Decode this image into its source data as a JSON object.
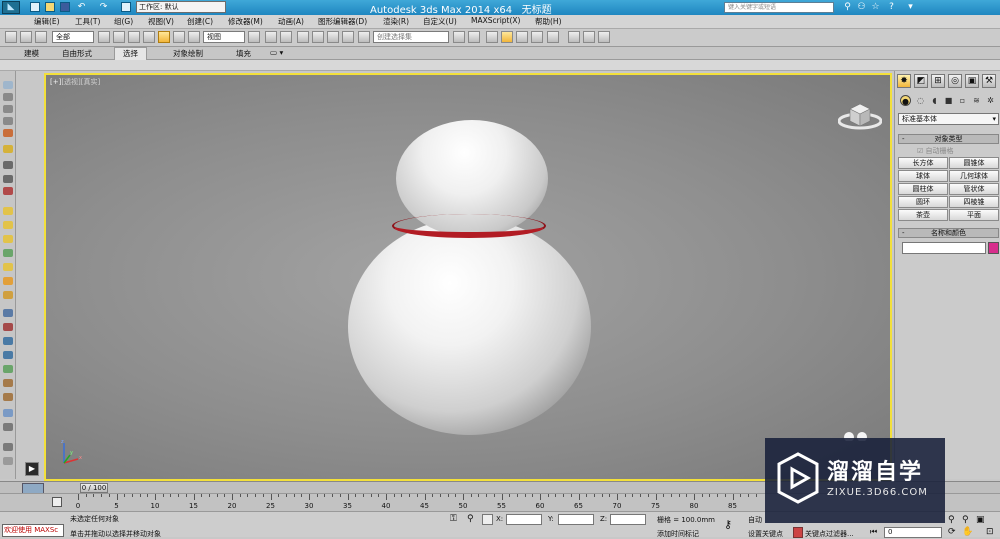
{
  "titlebar": {
    "workspace": "工作区: 默认",
    "app_title": "Autodesk 3ds Max  2014 x64",
    "doc_title": "无标题",
    "search_placeholder": "键入关键字或短语",
    "ime": "中 ⁾ • ♦ ⚙"
  },
  "menu": [
    "编辑(E)",
    "工具(T)",
    "组(G)",
    "视图(V)",
    "创建(C)",
    "修改器(M)",
    "动画(A)",
    "图形编辑器(D)",
    "渲染(R)",
    "自定义(U)",
    "MAXScript(X)",
    "帮助(H)"
  ],
  "toolbar": {
    "selection_filter": "全部",
    "ref_coord": "视图",
    "named_selection": "创建选择集"
  },
  "ribbon": {
    "tabs": [
      "建模",
      "自由形式",
      "选择",
      "对象绘制",
      "填充"
    ],
    "active": "选择"
  },
  "viewport": {
    "label_plus": "[+]",
    "label_view": "[透视]",
    "label_shading": "[真实]",
    "border_color": "#f3e03a"
  },
  "command_panel": {
    "category": "标准基本体",
    "rollout_object_type": "对象类型",
    "autogrid": "自动栅格",
    "objects": [
      "长方体",
      "圆锥体",
      "球体",
      "几何球体",
      "圆柱体",
      "管状体",
      "圆环",
      "四棱锥",
      "茶壶",
      "平面"
    ],
    "rollout_name_color": "名称和颜色",
    "object_color": "#d72d8c"
  },
  "timeline": {
    "slider": "0 / 100",
    "ticks": [
      "0",
      "5",
      "10",
      "15",
      "20",
      "25",
      "30",
      "35",
      "40",
      "45",
      "50",
      "55",
      "60",
      "65",
      "70",
      "75",
      "80",
      "85"
    ]
  },
  "status": {
    "maxscript": "欢迎使用 MAXSc",
    "line1": "未选定任何对象",
    "line2": "单击并拖动以选择并移动对象",
    "x_label": "X:",
    "y_label": "Y:",
    "z_label": "Z:",
    "grid": "栅格 = 100.0mm",
    "add_time_tag": "添加时间标记",
    "auto_key": "自动",
    "set_key": "设置关键点",
    "key_filters": "关键点过滤器...",
    "frame": "0"
  },
  "watermark": {
    "brand": "溜溜自学",
    "url": "ZIXUE.3D66.COM"
  }
}
